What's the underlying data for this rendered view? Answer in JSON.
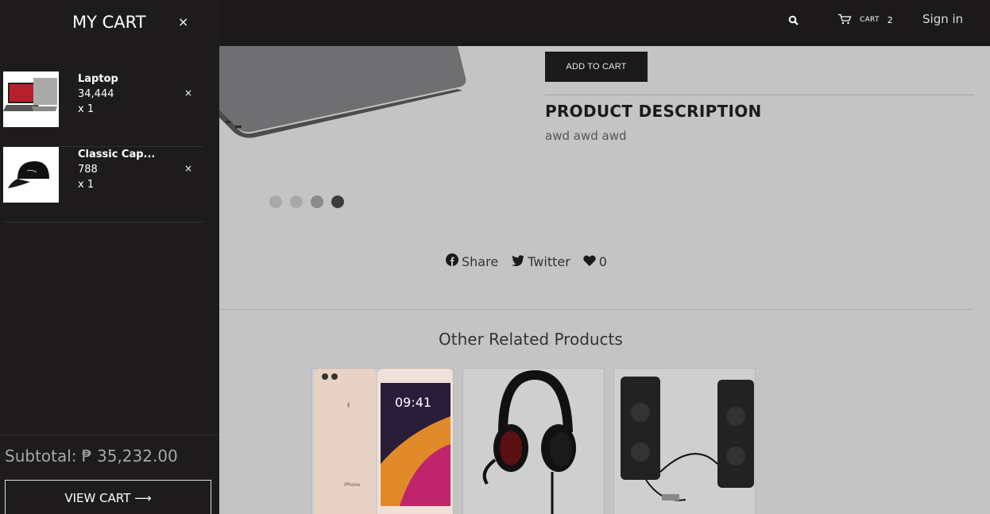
{
  "drawer": {
    "title": "MY CART",
    "close_glyph": "×",
    "items": [
      {
        "name": "Laptop",
        "price": "34,444",
        "qty": "x 1",
        "remove_glyph": "×",
        "thumb_icon": "laptop-thumbnail"
      },
      {
        "name": "Classic Cap...",
        "price": "788",
        "qty": "x 1",
        "remove_glyph": "×",
        "thumb_icon": "cap-thumbnail"
      }
    ],
    "subtotal": "Subtotal: ₱ 35,232.00",
    "view_cart": "VIEW CART ⟶"
  },
  "header": {
    "search_icon": "search-icon",
    "cart_icon": "cart-icon",
    "cart_label": "CART",
    "cart_count": "2",
    "signin": "Sign in"
  },
  "product": {
    "add_to_cart": "ADD TO CART",
    "description_title": "PRODUCT DESCRIPTION",
    "description_text": "awd awd awd",
    "carousel_dots": 4,
    "carousel_active": 4
  },
  "social": {
    "share": "Share",
    "twitter": "Twitter",
    "likes": "0"
  },
  "related": {
    "title": "Other Related Products",
    "items": [
      {
        "icon": "iphone-image"
      },
      {
        "icon": "headset-image"
      },
      {
        "icon": "speakers-image"
      }
    ]
  }
}
